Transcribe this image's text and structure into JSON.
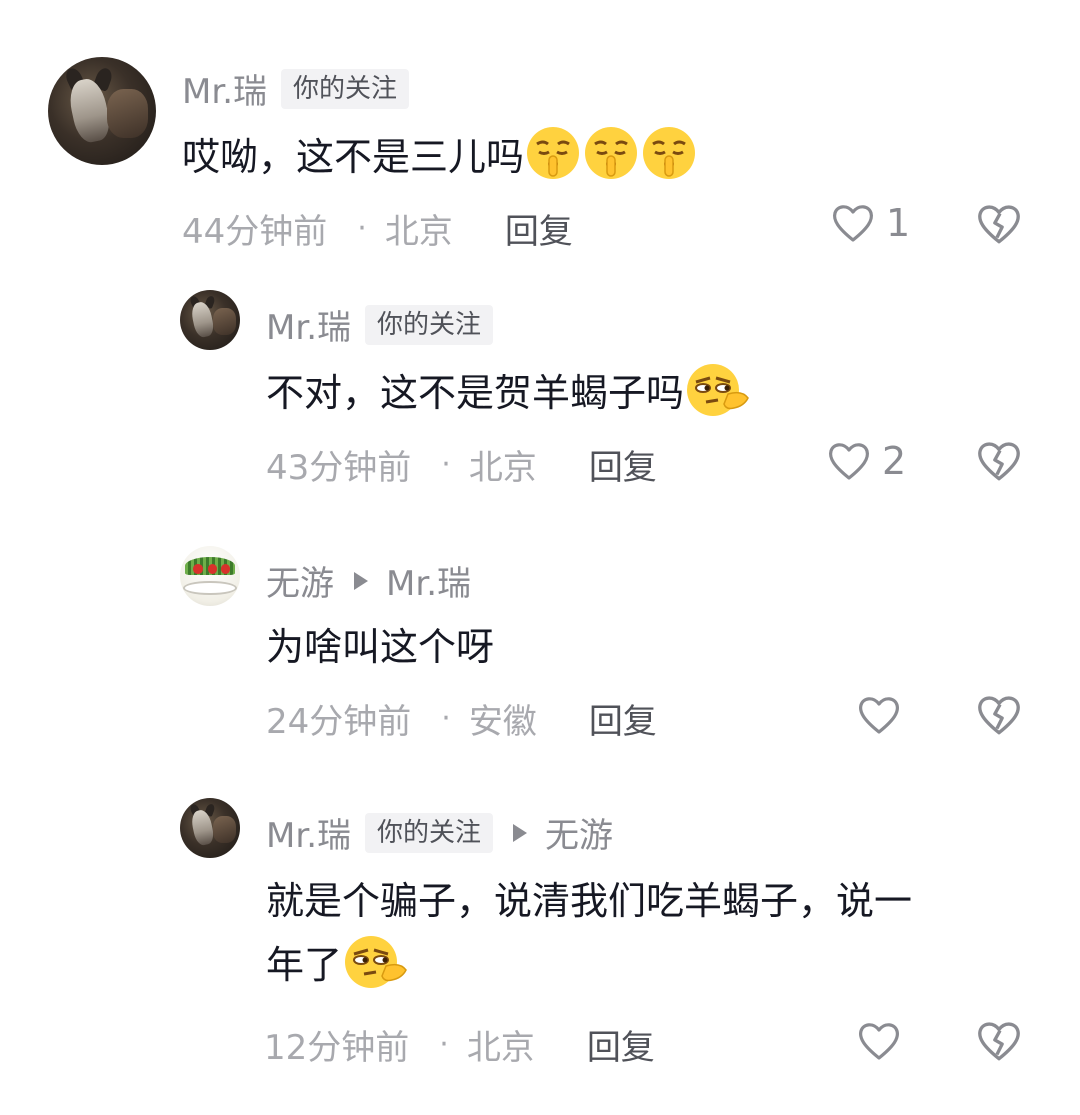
{
  "comments": [
    {
      "name": "Mr.瑞",
      "tag": "你的关注",
      "text": "哎呦，这不是三儿吗",
      "time": "44分钟前",
      "dot": "·",
      "location": "北京",
      "reply": "回复",
      "likes": "1",
      "emoji": "shush-emoji"
    },
    {
      "name": "Mr.瑞",
      "tag": "你的关注",
      "text": "不对，这不是贺羊蝎子吗",
      "time": "43分钟前",
      "dot": "·",
      "location": "北京",
      "reply": "回复",
      "likes": "2",
      "emoji": "side-eye-emoji"
    },
    {
      "name": "无游",
      "reply_to": "Mr.瑞",
      "text": "为啥叫这个呀",
      "time": "24分钟前",
      "dot": "·",
      "location": "安徽",
      "reply": "回复",
      "likes": ""
    },
    {
      "name": "Mr.瑞",
      "tag": "你的关注",
      "reply_to": "无游",
      "text_line1": "就是个骗子，说清我们吃羊蝎子，说一",
      "text_line2": "年了",
      "time": "12分钟前",
      "dot": "·",
      "location": "北京",
      "reply": "回复",
      "likes": "",
      "emoji": "side-eye-emoji"
    }
  ]
}
